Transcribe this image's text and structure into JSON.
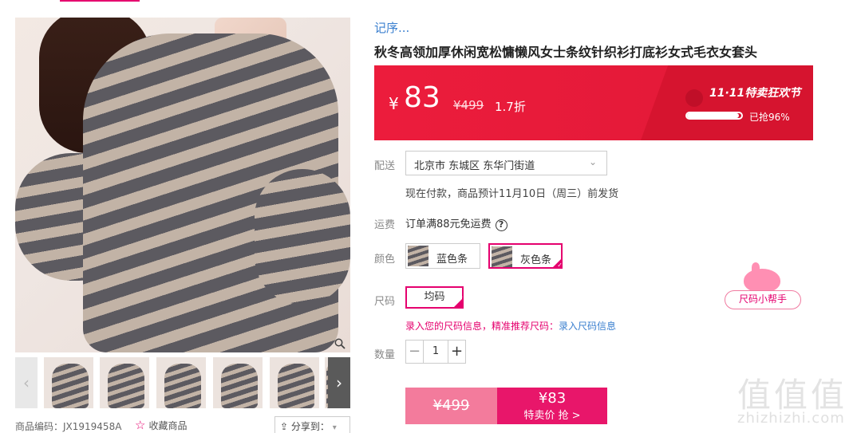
{
  "product": {
    "series": "记序...",
    "title": "秋冬高领加厚休闲宽松慵懒风女士条纹针织衫打底衫女式毛衣女套头"
  },
  "price": {
    "currency": "¥",
    "current": "83",
    "original": "¥499",
    "discount": "1.7折",
    "festival": "11·11特卖狂欢节",
    "grabbed_label": "已抢96%",
    "grabbed_fraction": 0.96
  },
  "delivery": {
    "label": "配送",
    "address": "北京市 东城区 东华门街道",
    "ship_note": "现在付款，商品预计11月10日（周三）前发货"
  },
  "freight": {
    "label": "运费",
    "text": "订单满88元免运费",
    "help": "?"
  },
  "color": {
    "label": "颜色",
    "options": [
      "蓝色条",
      "灰色条"
    ],
    "selected": "灰色条"
  },
  "size": {
    "label": "尺码",
    "options": [
      "均码"
    ],
    "tip": "录入您的尺码信息，精准推荐尺码：",
    "tip_link": "录入尺码信息",
    "helper": "尺码小帮手"
  },
  "quantity": {
    "label": "数量",
    "value": "1",
    "minus": "−",
    "plus": "+"
  },
  "buy": {
    "original": "¥499",
    "price": "¥83",
    "action": "特卖价 抢 >"
  },
  "gallery": {
    "prev": "‹",
    "next": "›",
    "thumb_count": 6
  },
  "meta": {
    "code": "商品编码：JX1919458A",
    "favorite": "收藏商品",
    "share": "分享到："
  },
  "watermark": {
    "mark": "值值值",
    "url": "zhizhizhi.com"
  },
  "colors": {
    "accent": "#e5006e",
    "price_bar": "#e11937",
    "link": "#3a7fcf"
  }
}
